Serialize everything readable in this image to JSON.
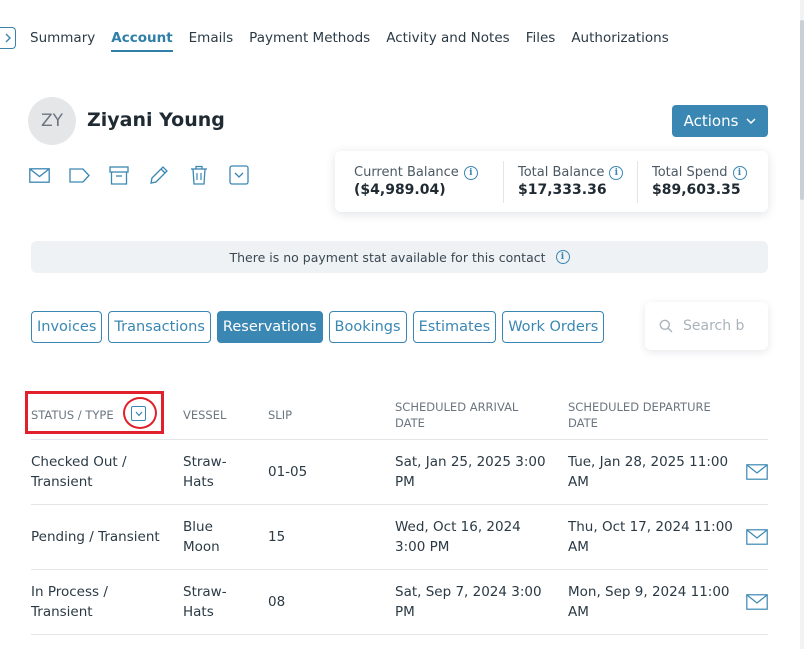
{
  "tabs": [
    {
      "label": "Summary",
      "active": false
    },
    {
      "label": "Account",
      "active": true
    },
    {
      "label": "Emails",
      "active": false
    },
    {
      "label": "Payment Methods",
      "active": false
    },
    {
      "label": "Activity and Notes",
      "active": false
    },
    {
      "label": "Files",
      "active": false
    },
    {
      "label": "Authorizations",
      "active": false
    }
  ],
  "contact": {
    "initials": "ZY",
    "name": "Ziyani Young"
  },
  "actions_label": "Actions",
  "balances": {
    "current": {
      "label": "Current Balance",
      "value": "($4,989.04)"
    },
    "total": {
      "label": "Total Balance",
      "value": "$17,333.36"
    },
    "spend": {
      "label": "Total Spend",
      "value": "$89,603.35"
    }
  },
  "notice": "There is no payment stat available for this contact",
  "filters": [
    {
      "label": "Invoices",
      "active": false
    },
    {
      "label": "Transactions",
      "active": false
    },
    {
      "label": "Reservations",
      "active": true
    },
    {
      "label": "Bookings",
      "active": false
    },
    {
      "label": "Estimates",
      "active": false
    },
    {
      "label": "Work Orders",
      "active": false
    }
  ],
  "search": {
    "placeholder": "Search b"
  },
  "table": {
    "headers": {
      "status": "STATUS / TYPE",
      "vessel": "VESSEL",
      "slip": "SLIP",
      "arrival_1": "SCHEDULED ARRIVAL",
      "arrival_2": "DATE",
      "departure_1": "SCHEDULED DEPARTURE",
      "departure_2": "DATE"
    },
    "rows": [
      {
        "status_1": "Checked Out /",
        "status_2": "Transient",
        "vessel_1": "Straw-",
        "vessel_2": "Hats",
        "slip": "01-05",
        "arrival_1": "Sat, Jan 25, 2025 3:00",
        "arrival_2": "PM",
        "departure_1": "Tue, Jan 28, 2025 11:00",
        "departure_2": "AM"
      },
      {
        "status_1": "Pending / Transient",
        "status_2": "",
        "vessel_1": "Blue",
        "vessel_2": "Moon",
        "slip": "15",
        "arrival_1": "Wed, Oct 16, 2024",
        "arrival_2": "3:00 PM",
        "departure_1": "Thu, Oct 17, 2024 11:00",
        "departure_2": "AM"
      },
      {
        "status_1": "In Process /",
        "status_2": "Transient",
        "vessel_1": "Straw-",
        "vessel_2": "Hats",
        "slip": "08",
        "arrival_1": "Sat, Sep 7, 2024 3:00",
        "arrival_2": "PM",
        "departure_1": "Mon, Sep 9, 2024 11:00",
        "departure_2": "AM"
      }
    ]
  },
  "colors": {
    "accent": "#3a87b3",
    "highlight": "#e0202a"
  }
}
